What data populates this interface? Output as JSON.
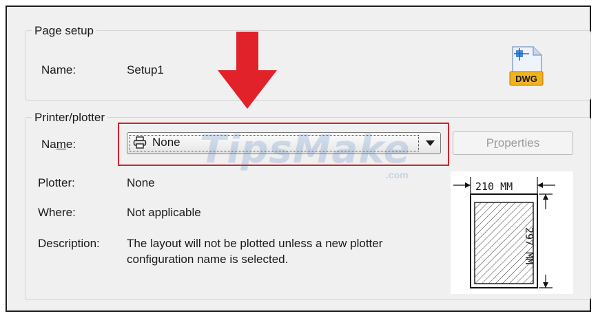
{
  "page_setup": {
    "legend": "Page setup",
    "name_label": "Name:",
    "name_value": "Setup1",
    "dwg_icon_text": "DWG"
  },
  "printer_plotter": {
    "legend": "Printer/plotter",
    "name_label_pre": "Na",
    "name_label_mnemonic": "m",
    "name_label_post": "e:",
    "selected": "None",
    "properties_pre": "P",
    "properties_mnemonic": "r",
    "properties_post": "operties",
    "plotter_label": "Plotter:",
    "plotter_value": "None",
    "where_label": "Where:",
    "where_value": "Not applicable",
    "description_label": "Description:",
    "description_line1": "The layout will not be plotted unless a new plotter",
    "description_line2": "configuration name is selected.",
    "paper_width": "210 MM",
    "paper_height": "297 MM"
  },
  "watermark": {
    "main": "TipsMake",
    "suffix": ".com"
  },
  "colors": {
    "highlight": "#d8202a",
    "arrow": "#e2222b",
    "dialog_bg": "#f0f0f0"
  }
}
